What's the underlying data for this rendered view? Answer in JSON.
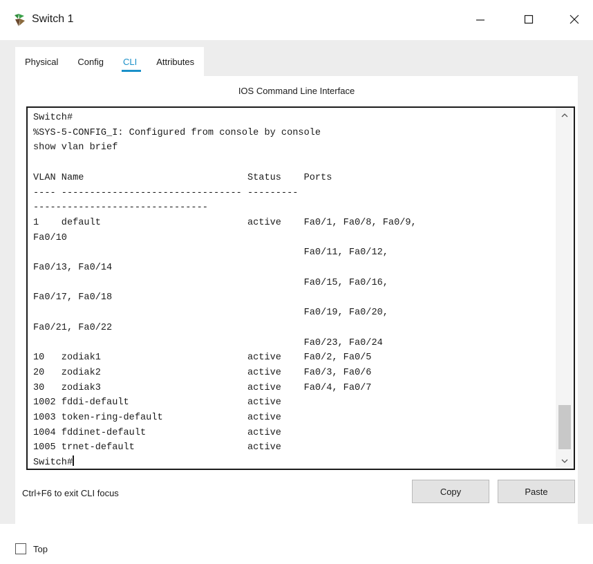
{
  "window": {
    "title": "Switch 1",
    "icon": "switch-app-icon"
  },
  "tabs": [
    {
      "label": "Physical",
      "active": false
    },
    {
      "label": "Config",
      "active": false
    },
    {
      "label": "CLI",
      "active": true
    },
    {
      "label": "Attributes",
      "active": false
    }
  ],
  "cli": {
    "panel_title": "IOS Command Line Interface",
    "terminal_lines": [
      "Switch#",
      "%SYS-5-CONFIG_I: Configured from console by console",
      "show vlan brief",
      "",
      "VLAN Name                             Status    Ports",
      "---- -------------------------------- --------- ",
      "-------------------------------",
      "1    default                          active    Fa0/1, Fa0/8, Fa0/9,",
      "Fa0/10",
      "                                                Fa0/11, Fa0/12,",
      "Fa0/13, Fa0/14",
      "                                                Fa0/15, Fa0/16,",
      "Fa0/17, Fa0/18",
      "                                                Fa0/19, Fa0/20,",
      "Fa0/21, Fa0/22",
      "                                                Fa0/23, Fa0/24",
      "10   zodiak1                          active    Fa0/2, Fa0/5",
      "20   zodiak2                          active    Fa0/3, Fa0/6",
      "30   zodiak3                          active    Fa0/4, Fa0/7",
      "1002 fddi-default                     active",
      "1003 token-ring-default               active",
      "1004 fddinet-default                  active",
      "1005 trnet-default                    active",
      "Switch#"
    ],
    "focus_hint": "Ctrl+F6 to exit CLI focus",
    "copy_label": "Copy",
    "paste_label": "Paste"
  },
  "bottom": {
    "top_label": "Top",
    "top_checked": false
  },
  "colors": {
    "accent": "#1a90c9",
    "client_bg": "#ededed",
    "terminal_border": "#1b1b1b"
  }
}
